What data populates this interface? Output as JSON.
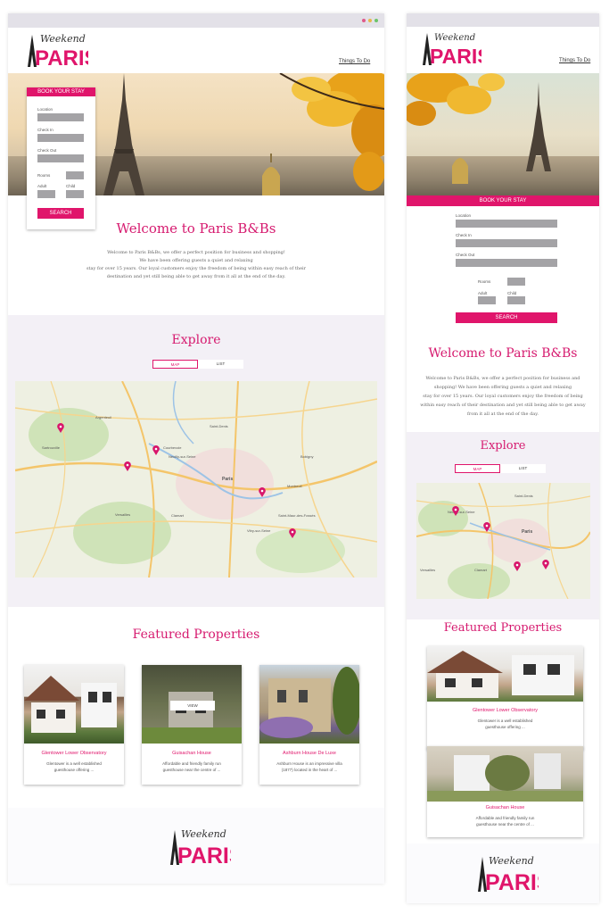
{
  "brand": {
    "logo_script": "Weekend",
    "logo_main": "PARIS",
    "accent": "#e0156b"
  },
  "nav": {
    "things_to_do": "Things To Do"
  },
  "booking": {
    "header": "BOOK YOUR STAY",
    "location": "Location",
    "check_in": "Check In",
    "check_out": "Check Out",
    "rooms": "Rooms",
    "adult": "Adult",
    "child": "Child",
    "search": "SEARCH"
  },
  "welcome": {
    "title": "Welcome to Paris B&Bs",
    "desktop_lines": [
      "Welcome to Paris B&Bs, we offer a perfect position for business and shopping!",
      "We have been offering guests a quiet and relaxing",
      "stay for over 15 years. Our loyal customers enjoy the freedom of being within easy reach of their",
      "destination and yet still being able to get away from it all at the end of the day."
    ],
    "mobile_lines": [
      "Welcome to Paris B&Bs, we offer a perfect position for business and",
      "shopping! We have been offering guests a quiet and relaxing",
      "stay for over 15 years. Our loyal customers enjoy the freedom of being",
      "within easy reach of their destination and yet still being able to get away",
      "from it all at the end of the day."
    ]
  },
  "explore": {
    "title": "Explore",
    "tab_map": "MAP",
    "tab_list": "LIST",
    "map_labels": [
      "Saint-Denis",
      "Paris",
      "Courbevoie",
      "Neuilly-sur-Seine",
      "Versailles",
      "Clamart",
      "Saint-Maur-des-Fossés",
      "Argenteuil",
      "Sartrouville",
      "Montreuil",
      "Bobigny",
      "Vitry-sur-Seine"
    ]
  },
  "featured": {
    "title": "Featured Properties",
    "view_label": "VIEW",
    "properties": [
      {
        "name": "Glentower Lower Observatory",
        "desc_1": "Glentower is a well established",
        "desc_2": "guesthouse offering ..."
      },
      {
        "name": "Guisachan House",
        "desc_1": "Affordable and friendly family run",
        "desc_2": "guesthouse near the centre of ..."
      },
      {
        "name": "Ashburn House De Luxe",
        "desc_1": "Ashburn House is an impressive villa",
        "desc_2": "(1877) located in the heart of ..."
      }
    ]
  }
}
